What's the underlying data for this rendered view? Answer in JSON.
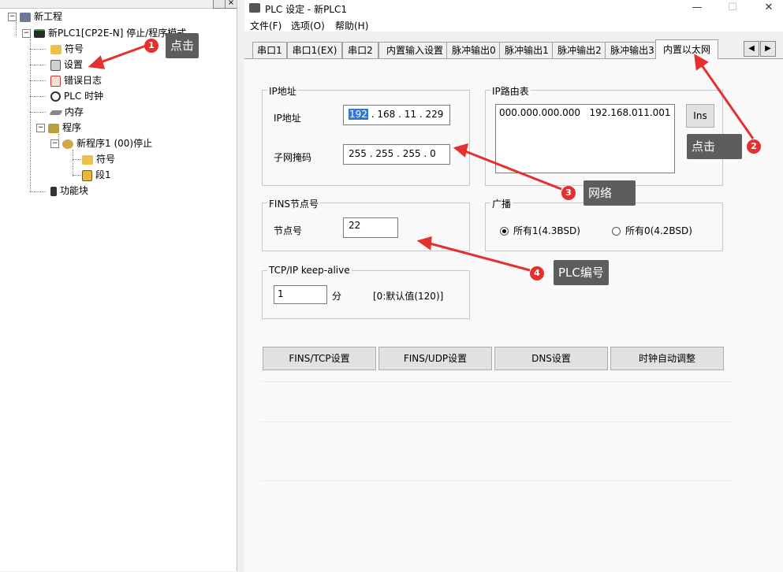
{
  "tree": {
    "items": [
      {
        "label": "新工程",
        "icon": "network-icon"
      },
      {
        "label": "新PLC1[CP2E-N] 停止/程序模式",
        "icon": "plc-icon"
      },
      {
        "label": "符号",
        "icon": "symbol-icon"
      },
      {
        "label": "设置",
        "icon": "settings-icon"
      },
      {
        "label": "错误日志",
        "icon": "error-log-icon"
      },
      {
        "label": "PLC 时钟",
        "icon": "clock-icon"
      },
      {
        "label": "内存",
        "icon": "memory-icon"
      },
      {
        "label": "程序",
        "icon": "program-icon"
      },
      {
        "label": "新程序1 (00)停止",
        "icon": "task-icon"
      },
      {
        "label": "符号",
        "icon": "symbol-icon"
      },
      {
        "label": "段1",
        "icon": "section-icon"
      },
      {
        "label": "功能块",
        "icon": "function-block-icon"
      }
    ],
    "close_glyph": "×"
  },
  "window": {
    "title": "PLC 设定 - 新PLC1",
    "controls": {
      "minimize": "—",
      "maximize": "☐",
      "close": "✕"
    }
  },
  "menu": [
    "文件(F)",
    "选项(O)",
    "帮助(H)"
  ],
  "tabs": [
    "串口1",
    "串口1(EX)",
    "串口2",
    "内置输入设置",
    "脉冲输出0",
    "脉冲输出1",
    "脉冲输出2",
    "脉冲输出3",
    "内置以太网"
  ],
  "active_tab": "内置以太网",
  "ip_group": {
    "title": "IP地址",
    "ip_label": "IP地址",
    "ip_octets": [
      "192",
      "168",
      "11",
      "229"
    ],
    "mask_label": "子网掩码",
    "mask_octets": [
      "255",
      "255",
      "255",
      "0"
    ]
  },
  "route_group": {
    "title": "IP路由表",
    "entry": "000.000.000.000   192.168.011.001",
    "ins_button": "Ins"
  },
  "fins_group": {
    "title": "FINS节点号",
    "node_label": "节点号",
    "node_value": "22"
  },
  "broadcast_group": {
    "title": "广播",
    "option1": "所有1(4.3BSD)",
    "option2": "所有0(4.2BSD)",
    "selected": "所有1(4.3BSD)"
  },
  "keepalive_group": {
    "title": "TCP/IP keep-alive",
    "value": "1",
    "unit": "分",
    "hint": "[0:默认值(120)]"
  },
  "buttons": [
    "FINS/TCP设置",
    "FINS/UDP设置",
    "DNS设置",
    "时钟自动调整"
  ],
  "annotations": [
    {
      "num": "1",
      "text": "点击"
    },
    {
      "num": "2",
      "text": "点击"
    },
    {
      "num": "3",
      "text": "网络"
    },
    {
      "num": "4",
      "text": "PLC编号"
    }
  ],
  "colors": {
    "annotation_bg": "#5d5d5d",
    "annotation_badge": "#e53030",
    "arrow": "#e53030",
    "selection": "#3078d8"
  }
}
